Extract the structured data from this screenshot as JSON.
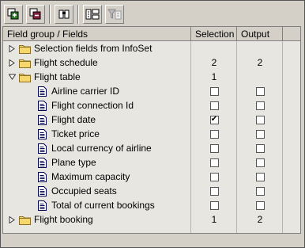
{
  "table": {
    "col_field": "Field group / Fields",
    "col_selection": "Selection",
    "col_output": "Output"
  },
  "toolbar": {
    "buttons": [
      "expand-all-icon",
      "collapse-all-icon",
      "find-icon",
      "layout-icon",
      "filter-icon"
    ]
  },
  "rows": [
    {
      "label": "Selection fields from InfoSet",
      "type": "group",
      "expanded": false,
      "selection": "",
      "output": ""
    },
    {
      "label": "Flight schedule",
      "type": "group",
      "expanded": false,
      "selection": "2",
      "output": "2"
    },
    {
      "label": "Flight table",
      "type": "group",
      "expanded": true,
      "selection": "1",
      "output": ""
    },
    {
      "label": "Airline carrier ID",
      "type": "field",
      "selection_checked": false,
      "output_checked": false
    },
    {
      "label": "Flight connection Id",
      "type": "field",
      "selection_checked": false,
      "output_checked": false
    },
    {
      "label": "Flight date",
      "type": "field",
      "selection_checked": true,
      "output_checked": false
    },
    {
      "label": "Ticket price",
      "type": "field",
      "selection_checked": false,
      "output_checked": false
    },
    {
      "label": "Local currency of airline",
      "type": "field",
      "selection_checked": false,
      "output_checked": false
    },
    {
      "label": "Plane type",
      "type": "field",
      "selection_checked": false,
      "output_checked": false
    },
    {
      "label": "Maximum capacity",
      "type": "field",
      "selection_checked": false,
      "output_checked": false
    },
    {
      "label": "Occupied seats",
      "type": "field",
      "selection_checked": false,
      "output_checked": false
    },
    {
      "label": "Total of current bookings",
      "type": "field",
      "selection_checked": false,
      "output_checked": false
    },
    {
      "label": "Flight booking",
      "type": "group",
      "expanded": false,
      "selection": "1",
      "output": "2"
    }
  ]
}
